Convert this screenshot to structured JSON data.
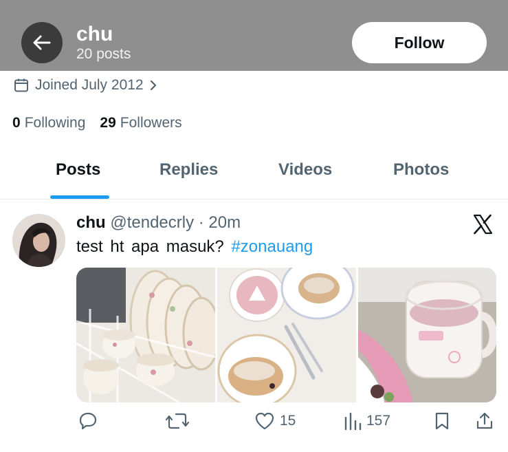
{
  "header": {
    "name": "chu",
    "post_count": "20 posts",
    "follow_label": "Follow"
  },
  "profile": {
    "joined": "Joined July 2012",
    "following_count": "0",
    "following_label": "Following",
    "followers_count": "29",
    "followers_label": "Followers"
  },
  "tabs": [
    {
      "label": "Posts",
      "active": true
    },
    {
      "label": "Replies",
      "active": false
    },
    {
      "label": "Videos",
      "active": false
    },
    {
      "label": "Photos",
      "active": false
    }
  ],
  "post": {
    "author_name": "chu",
    "handle_time": "@tendecrly · 20m",
    "text": "test ht apa masuk?",
    "hashtag": "#zonauang",
    "likes": "15",
    "views": "157"
  },
  "colors": {
    "header_bg": "#8f8f8f",
    "accent": "#1d9bf0",
    "muted_text": "#536471"
  },
  "icons": [
    "back-arrow-icon",
    "calendar-icon",
    "chevron-right-icon",
    "x-logo-icon",
    "reply-icon",
    "repost-icon",
    "like-icon",
    "views-icon",
    "bookmark-icon",
    "share-icon"
  ]
}
